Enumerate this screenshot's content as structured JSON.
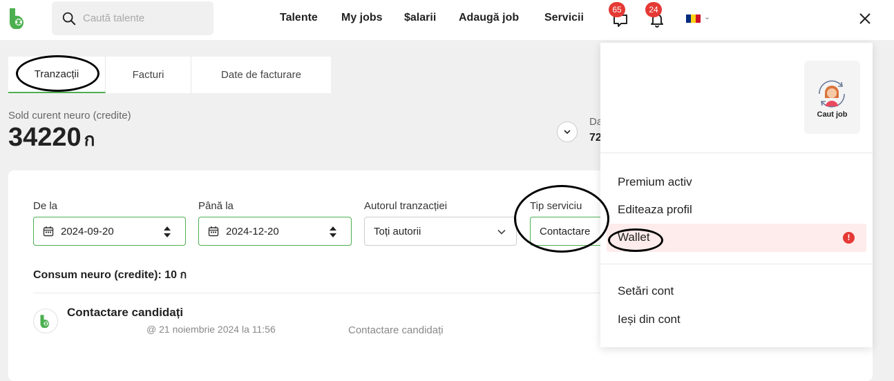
{
  "header": {
    "search_placeholder": "Caută talente",
    "nav": [
      "Talente",
      "My jobs",
      "$alarii",
      "Adaugă job",
      "Servicii"
    ],
    "messages_count": "65",
    "notifications_count": "24",
    "language": "ro"
  },
  "tabs": [
    "Tranzacții",
    "Facturi",
    "Date de facturare"
  ],
  "balance": {
    "label": "Sold curent neuro (credite)",
    "value": "34220",
    "unit": "ก"
  },
  "side_summary": {
    "label_partial": "Da",
    "value_partial": "72"
  },
  "filters": {
    "from_label": "De la",
    "from_value": "2024-09-20",
    "to_label": "Până la",
    "to_value": "2024-12-20",
    "author_label": "Autorul tranzacției",
    "author_value": "Toți autorii",
    "service_label": "Tip serviciu",
    "service_value": "Contactare"
  },
  "consumption": "Consum neuro (credite): 10 ก",
  "transactions": [
    {
      "title": "Contactare candidați",
      "date": "@ 21 noiembrie 2024 la 11:56",
      "type": "Contactare candidați"
    }
  ],
  "menu": {
    "profile_label": "Caut job",
    "items": [
      "Premium activ",
      "Editeaza profil",
      "Wallet",
      "Setări cont",
      "Ieși din cont"
    ]
  },
  "colors": {
    "accent_green": "#4caf50",
    "badge_red": "#e53935",
    "wallet_highlight": "#fdeceb"
  }
}
